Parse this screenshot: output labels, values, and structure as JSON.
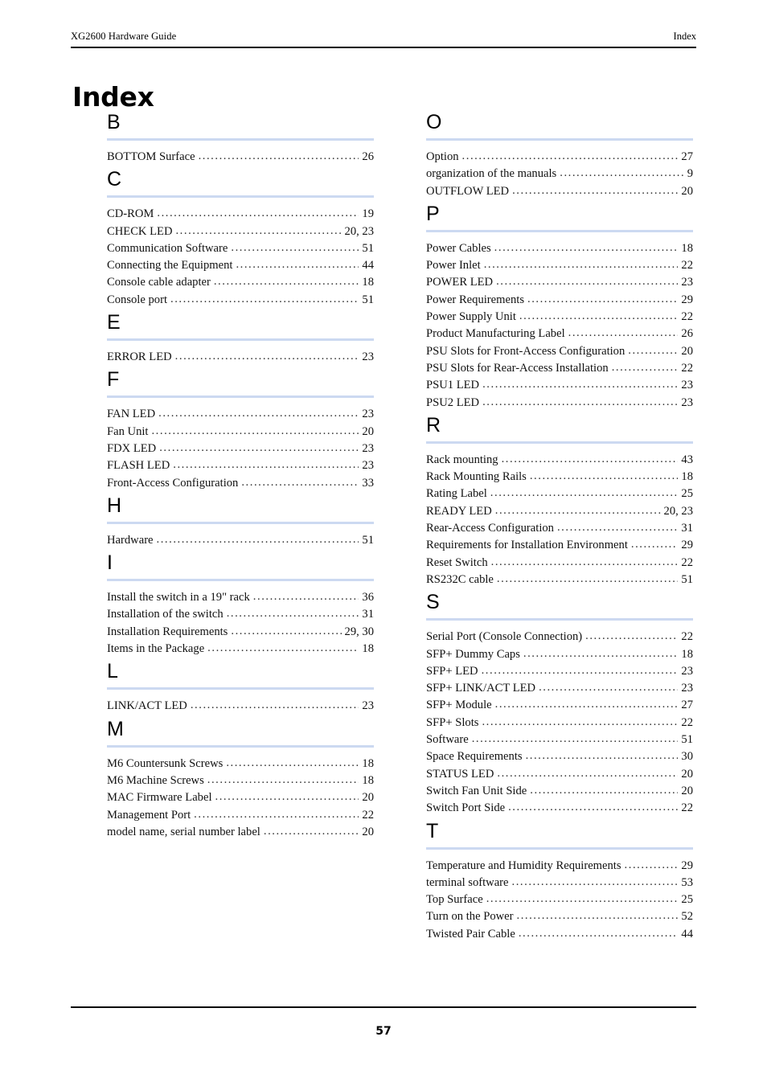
{
  "header": {
    "left": "XG2600 Hardware Guide",
    "right": "Index"
  },
  "title": "Index",
  "footer": {
    "page_number": "57"
  },
  "accent_rule_color": "#ccd9f1",
  "columns": [
    {
      "name": "left-column",
      "groups": [
        {
          "letter": "B",
          "entries": [
            {
              "text": "BOTTOM Surface",
              "page": "26"
            }
          ]
        },
        {
          "letter": "C",
          "entries": [
            {
              "text": "CD-ROM",
              "page": "19"
            },
            {
              "text": "CHECK LED",
              "page": "20, 23"
            },
            {
              "text": "Communication Software",
              "page": "51"
            },
            {
              "text": "Connecting the Equipment",
              "page": "44"
            },
            {
              "text": "Console cable adapter",
              "page": "18"
            },
            {
              "text": "Console port",
              "page": "51"
            }
          ]
        },
        {
          "letter": "E",
          "entries": [
            {
              "text": "ERROR LED",
              "page": "23"
            }
          ]
        },
        {
          "letter": "F",
          "entries": [
            {
              "text": "FAN LED",
              "page": "23"
            },
            {
              "text": "Fan Unit",
              "page": "20"
            },
            {
              "text": "FDX LED",
              "page": "23"
            },
            {
              "text": "FLASH LED",
              "page": "23"
            },
            {
              "text": "Front-Access Configuration",
              "page": "33"
            }
          ]
        },
        {
          "letter": "H",
          "entries": [
            {
              "text": "Hardware",
              "page": "51"
            }
          ]
        },
        {
          "letter": "I",
          "entries": [
            {
              "text": "Install the switch in a 19\" rack",
              "page": "36"
            },
            {
              "text": "Installation of the switch",
              "page": "31"
            },
            {
              "text": "Installation Requirements",
              "page": "29, 30"
            },
            {
              "text": "Items in the Package",
              "page": "18"
            }
          ]
        },
        {
          "letter": "L",
          "entries": [
            {
              "text": "LINK/ACT LED",
              "page": "23"
            }
          ]
        },
        {
          "letter": "M",
          "entries": [
            {
              "text": "M6 Countersunk Screws",
              "page": "18"
            },
            {
              "text": "M6 Machine Screws",
              "page": "18"
            },
            {
              "text": "MAC Firmware Label",
              "page": "20"
            },
            {
              "text": "Management Port",
              "page": "22"
            },
            {
              "text": "model name, serial number label",
              "page": "20"
            }
          ]
        }
      ]
    },
    {
      "name": "right-column",
      "groups": [
        {
          "letter": "O",
          "entries": [
            {
              "text": "Option",
              "page": "27"
            },
            {
              "text": "organization of the manuals",
              "page": "9"
            },
            {
              "text": "OUTFLOW LED",
              "page": "20"
            }
          ]
        },
        {
          "letter": "P",
          "entries": [
            {
              "text": "Power Cables",
              "page": "18"
            },
            {
              "text": "Power Inlet",
              "page": "22"
            },
            {
              "text": "POWER LED",
              "page": "23"
            },
            {
              "text": "Power Requirements",
              "page": "29"
            },
            {
              "text": "Power Supply Unit",
              "page": "22"
            },
            {
              "text": "Product Manufacturing Label",
              "page": "26"
            },
            {
              "text": "PSU Slots for Front-Access Configuration",
              "page": "20"
            },
            {
              "text": "PSU Slots for Rear-Access Installation",
              "page": "22"
            },
            {
              "text": "PSU1 LED",
              "page": "23"
            },
            {
              "text": "PSU2 LED",
              "page": "23"
            }
          ]
        },
        {
          "letter": "R",
          "entries": [
            {
              "text": "Rack mounting",
              "page": "43"
            },
            {
              "text": "Rack Mounting Rails",
              "page": "18"
            },
            {
              "text": "Rating Label",
              "page": "25"
            },
            {
              "text": "READY LED",
              "page": "20, 23"
            },
            {
              "text": "Rear-Access Configuration",
              "page": "31"
            },
            {
              "text": "Requirements for Installation Environment",
              "page": "29"
            },
            {
              "text": "Reset Switch",
              "page": "22"
            },
            {
              "text": "RS232C cable",
              "page": "51"
            }
          ]
        },
        {
          "letter": "S",
          "entries": [
            {
              "text": "Serial Port (Console Connection)",
              "page": "22"
            },
            {
              "text": "SFP+ Dummy Caps",
              "page": "18"
            },
            {
              "text": "SFP+ LED",
              "page": "23"
            },
            {
              "text": "SFP+ LINK/ACT LED",
              "page": "23"
            },
            {
              "text": "SFP+ Module",
              "page": "27"
            },
            {
              "text": "SFP+ Slots",
              "page": "22"
            },
            {
              "text": "Software",
              "page": "51"
            },
            {
              "text": "Space Requirements",
              "page": "30"
            },
            {
              "text": "STATUS LED",
              "page": "20"
            },
            {
              "text": "Switch Fan Unit Side",
              "page": "20"
            },
            {
              "text": "Switch Port Side",
              "page": "22"
            }
          ]
        },
        {
          "letter": "T",
          "entries": [
            {
              "text": "Temperature and Humidity Requirements",
              "page": "29"
            },
            {
              "text": "terminal software",
              "page": "53"
            },
            {
              "text": "Top Surface",
              "page": "25"
            },
            {
              "text": "Turn on the Power",
              "page": "52"
            },
            {
              "text": "Twisted Pair Cable",
              "page": "44"
            }
          ]
        }
      ]
    }
  ]
}
